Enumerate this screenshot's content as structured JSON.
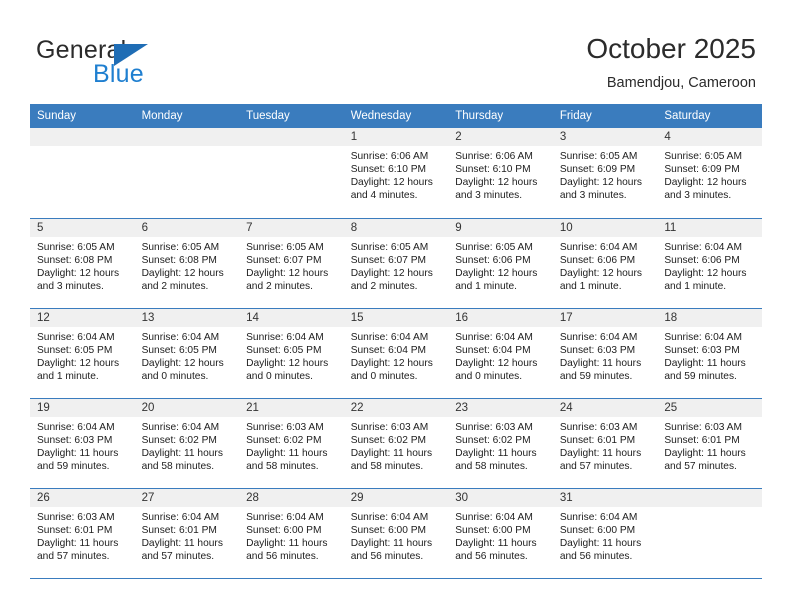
{
  "brand": {
    "word1": "General",
    "word2": "Blue",
    "triangle_color": "#1f6db5",
    "blue_color": "#1f7fd0"
  },
  "header": {
    "title": "October 2025",
    "subtitle": "Bamendjou, Cameroon"
  },
  "theme": {
    "header_blue": "#3a7cbe",
    "daynum_gray": "#f0f0f0",
    "text": "#1d1d1d"
  },
  "weekday_headers": [
    "Sunday",
    "Monday",
    "Tuesday",
    "Wednesday",
    "Thursday",
    "Friday",
    "Saturday"
  ],
  "labels": {
    "sunrise": "Sunrise:",
    "sunset": "Sunset:",
    "daylight": "Daylight:"
  },
  "weeks": [
    [
      {
        "day": "",
        "l1": "",
        "l2": "",
        "l3": "",
        "l4": ""
      },
      {
        "day": "",
        "l1": "",
        "l2": "",
        "l3": "",
        "l4": ""
      },
      {
        "day": "",
        "l1": "",
        "l2": "",
        "l3": "",
        "l4": ""
      },
      {
        "day": "1",
        "l1": "Sunrise: 6:06 AM",
        "l2": "Sunset: 6:10 PM",
        "l3": "Daylight: 12 hours",
        "l4": "and 4 minutes."
      },
      {
        "day": "2",
        "l1": "Sunrise: 6:06 AM",
        "l2": "Sunset: 6:10 PM",
        "l3": "Daylight: 12 hours",
        "l4": "and 3 minutes."
      },
      {
        "day": "3",
        "l1": "Sunrise: 6:05 AM",
        "l2": "Sunset: 6:09 PM",
        "l3": "Daylight: 12 hours",
        "l4": "and 3 minutes."
      },
      {
        "day": "4",
        "l1": "Sunrise: 6:05 AM",
        "l2": "Sunset: 6:09 PM",
        "l3": "Daylight: 12 hours",
        "l4": "and 3 minutes."
      }
    ],
    [
      {
        "day": "5",
        "l1": "Sunrise: 6:05 AM",
        "l2": "Sunset: 6:08 PM",
        "l3": "Daylight: 12 hours",
        "l4": "and 3 minutes."
      },
      {
        "day": "6",
        "l1": "Sunrise: 6:05 AM",
        "l2": "Sunset: 6:08 PM",
        "l3": "Daylight: 12 hours",
        "l4": "and 2 minutes."
      },
      {
        "day": "7",
        "l1": "Sunrise: 6:05 AM",
        "l2": "Sunset: 6:07 PM",
        "l3": "Daylight: 12 hours",
        "l4": "and 2 minutes."
      },
      {
        "day": "8",
        "l1": "Sunrise: 6:05 AM",
        "l2": "Sunset: 6:07 PM",
        "l3": "Daylight: 12 hours",
        "l4": "and 2 minutes."
      },
      {
        "day": "9",
        "l1": "Sunrise: 6:05 AM",
        "l2": "Sunset: 6:06 PM",
        "l3": "Daylight: 12 hours",
        "l4": "and 1 minute."
      },
      {
        "day": "10",
        "l1": "Sunrise: 6:04 AM",
        "l2": "Sunset: 6:06 PM",
        "l3": "Daylight: 12 hours",
        "l4": "and 1 minute."
      },
      {
        "day": "11",
        "l1": "Sunrise: 6:04 AM",
        "l2": "Sunset: 6:06 PM",
        "l3": "Daylight: 12 hours",
        "l4": "and 1 minute."
      }
    ],
    [
      {
        "day": "12",
        "l1": "Sunrise: 6:04 AM",
        "l2": "Sunset: 6:05 PM",
        "l3": "Daylight: 12 hours",
        "l4": "and 1 minute."
      },
      {
        "day": "13",
        "l1": "Sunrise: 6:04 AM",
        "l2": "Sunset: 6:05 PM",
        "l3": "Daylight: 12 hours",
        "l4": "and 0 minutes."
      },
      {
        "day": "14",
        "l1": "Sunrise: 6:04 AM",
        "l2": "Sunset: 6:05 PM",
        "l3": "Daylight: 12 hours",
        "l4": "and 0 minutes."
      },
      {
        "day": "15",
        "l1": "Sunrise: 6:04 AM",
        "l2": "Sunset: 6:04 PM",
        "l3": "Daylight: 12 hours",
        "l4": "and 0 minutes."
      },
      {
        "day": "16",
        "l1": "Sunrise: 6:04 AM",
        "l2": "Sunset: 6:04 PM",
        "l3": "Daylight: 12 hours",
        "l4": "and 0 minutes."
      },
      {
        "day": "17",
        "l1": "Sunrise: 6:04 AM",
        "l2": "Sunset: 6:03 PM",
        "l3": "Daylight: 11 hours",
        "l4": "and 59 minutes."
      },
      {
        "day": "18",
        "l1": "Sunrise: 6:04 AM",
        "l2": "Sunset: 6:03 PM",
        "l3": "Daylight: 11 hours",
        "l4": "and 59 minutes."
      }
    ],
    [
      {
        "day": "19",
        "l1": "Sunrise: 6:04 AM",
        "l2": "Sunset: 6:03 PM",
        "l3": "Daylight: 11 hours",
        "l4": "and 59 minutes."
      },
      {
        "day": "20",
        "l1": "Sunrise: 6:04 AM",
        "l2": "Sunset: 6:02 PM",
        "l3": "Daylight: 11 hours",
        "l4": "and 58 minutes."
      },
      {
        "day": "21",
        "l1": "Sunrise: 6:03 AM",
        "l2": "Sunset: 6:02 PM",
        "l3": "Daylight: 11 hours",
        "l4": "and 58 minutes."
      },
      {
        "day": "22",
        "l1": "Sunrise: 6:03 AM",
        "l2": "Sunset: 6:02 PM",
        "l3": "Daylight: 11 hours",
        "l4": "and 58 minutes."
      },
      {
        "day": "23",
        "l1": "Sunrise: 6:03 AM",
        "l2": "Sunset: 6:02 PM",
        "l3": "Daylight: 11 hours",
        "l4": "and 58 minutes."
      },
      {
        "day": "24",
        "l1": "Sunrise: 6:03 AM",
        "l2": "Sunset: 6:01 PM",
        "l3": "Daylight: 11 hours",
        "l4": "and 57 minutes."
      },
      {
        "day": "25",
        "l1": "Sunrise: 6:03 AM",
        "l2": "Sunset: 6:01 PM",
        "l3": "Daylight: 11 hours",
        "l4": "and 57 minutes."
      }
    ],
    [
      {
        "day": "26",
        "l1": "Sunrise: 6:03 AM",
        "l2": "Sunset: 6:01 PM",
        "l3": "Daylight: 11 hours",
        "l4": "and 57 minutes."
      },
      {
        "day": "27",
        "l1": "Sunrise: 6:04 AM",
        "l2": "Sunset: 6:01 PM",
        "l3": "Daylight: 11 hours",
        "l4": "and 57 minutes."
      },
      {
        "day": "28",
        "l1": "Sunrise: 6:04 AM",
        "l2": "Sunset: 6:00 PM",
        "l3": "Daylight: 11 hours",
        "l4": "and 56 minutes."
      },
      {
        "day": "29",
        "l1": "Sunrise: 6:04 AM",
        "l2": "Sunset: 6:00 PM",
        "l3": "Daylight: 11 hours",
        "l4": "and 56 minutes."
      },
      {
        "day": "30",
        "l1": "Sunrise: 6:04 AM",
        "l2": "Sunset: 6:00 PM",
        "l3": "Daylight: 11 hours",
        "l4": "and 56 minutes."
      },
      {
        "day": "31",
        "l1": "Sunrise: 6:04 AM",
        "l2": "Sunset: 6:00 PM",
        "l3": "Daylight: 11 hours",
        "l4": "and 56 minutes."
      },
      {
        "day": "",
        "l1": "",
        "l2": "",
        "l3": "",
        "l4": ""
      }
    ]
  ]
}
